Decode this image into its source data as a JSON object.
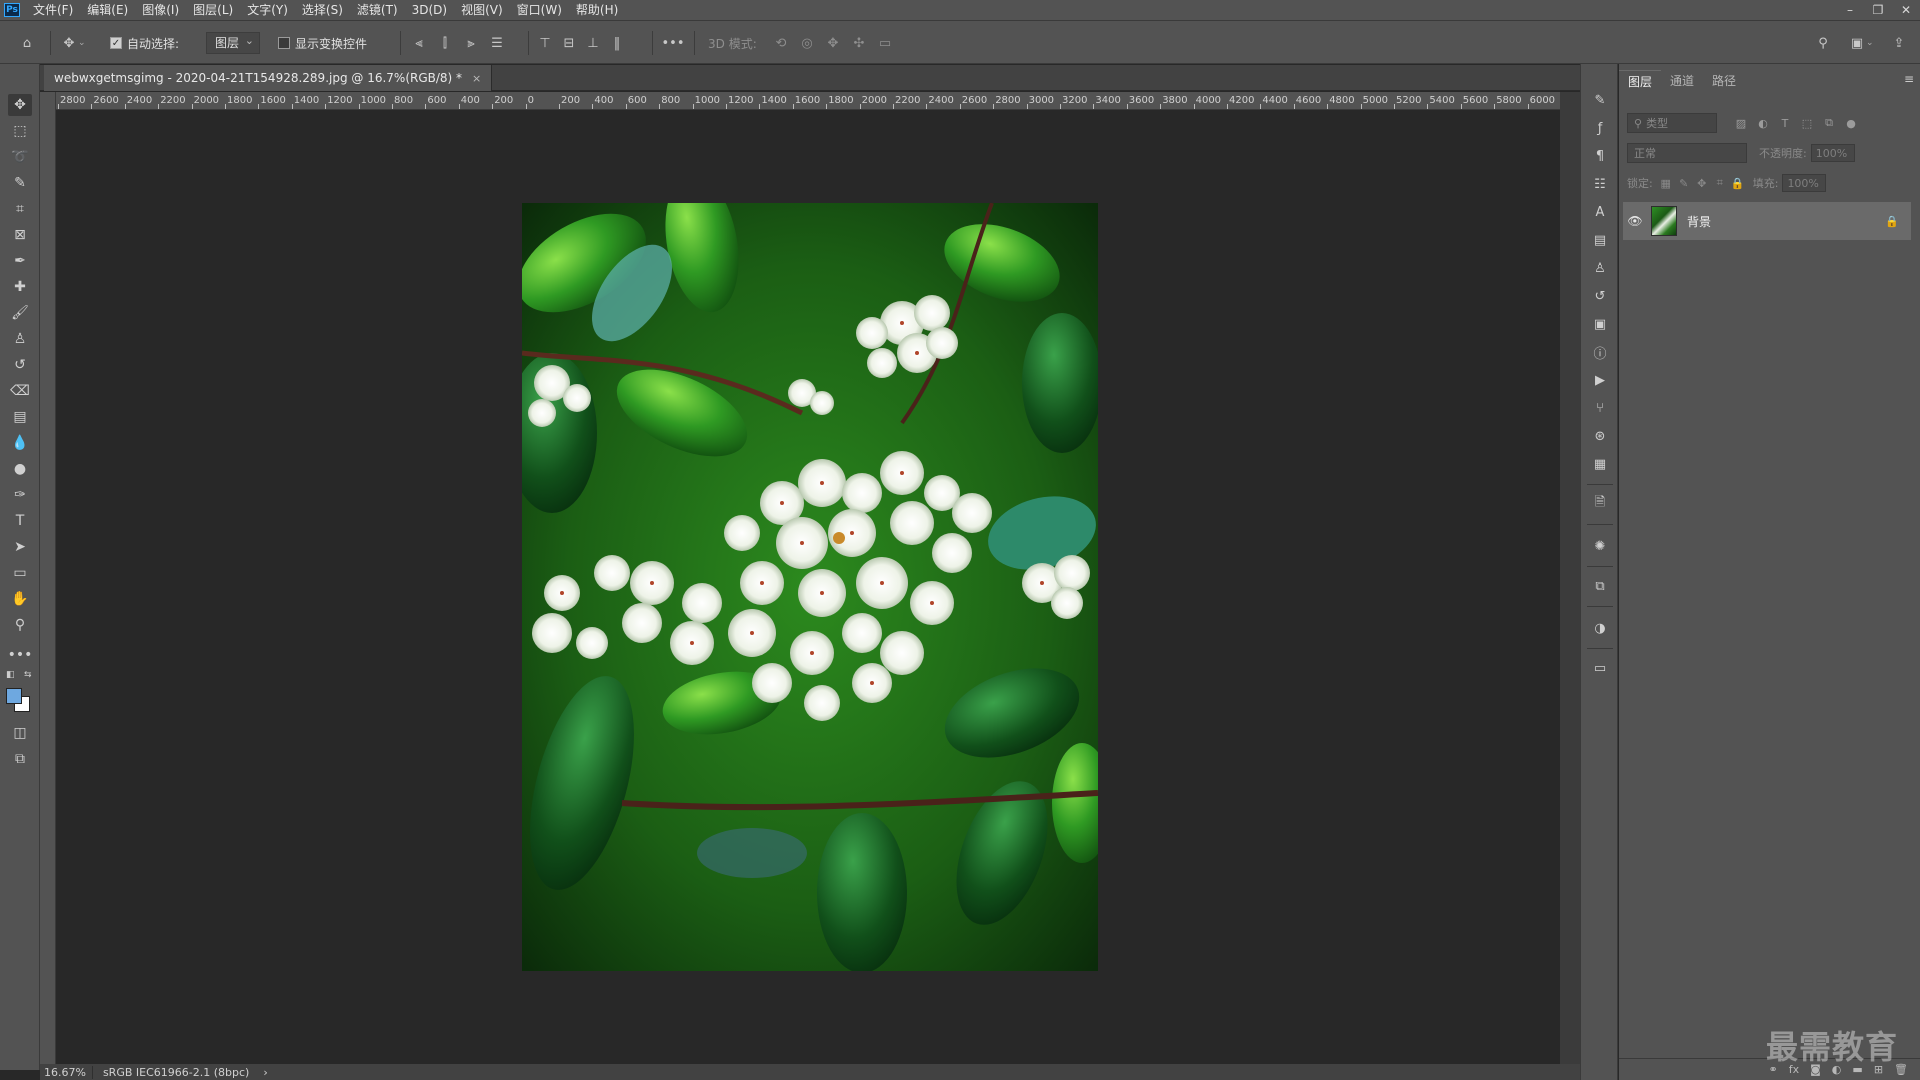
{
  "menubar": {
    "logo": "Ps",
    "items": [
      "文件(F)",
      "编辑(E)",
      "图像(I)",
      "图层(L)",
      "文字(Y)",
      "选择(S)",
      "滤镜(T)",
      "3D(D)",
      "视图(V)",
      "窗口(W)",
      "帮助(H)"
    ]
  },
  "options": {
    "auto_select_label": "自动选择:",
    "auto_select_checked": true,
    "target_value": "图层",
    "show_transform_label": "显示变换控件",
    "show_transform_checked": false,
    "mode_3d_label": "3D 模式:"
  },
  "document": {
    "tab_title": "webwxgetmsgimg - 2020-04-21T154928.289.jpg @ 16.7%(RGB/8) *",
    "ruler_labels": [
      "2800",
      "2600",
      "2400",
      "2200",
      "2000",
      "1800",
      "1600",
      "1400",
      "1200",
      "1000",
      "800",
      "600",
      "400",
      "200",
      "0",
      "200",
      "400",
      "600",
      "800",
      "1000",
      "1200",
      "1400",
      "1600",
      "1800",
      "2000",
      "2200",
      "2400",
      "2600",
      "2800",
      "3000",
      "3200",
      "3400",
      "3600",
      "3800",
      "4000",
      "4200",
      "4400",
      "4600",
      "4800",
      "5000",
      "5200",
      "5400",
      "5600",
      "5800",
      "6000"
    ]
  },
  "status": {
    "zoom": "16.67%",
    "profile": "sRGB IEC61966-2.1 (8bpc)"
  },
  "layers_panel": {
    "tabs": [
      "图层",
      "通道",
      "路径"
    ],
    "filter_placeholder": "类型",
    "blend_mode": "正常",
    "opacity_label": "不透明度:",
    "opacity_value": "100%",
    "lock_label": "锁定:",
    "fill_label": "填充:",
    "fill_value": "100%",
    "layers": [
      {
        "name": "背景",
        "visible": true,
        "locked": true
      }
    ]
  },
  "watermark": "最需教育",
  "colors": {
    "foreground": "#6ea8e0",
    "background": "#ffffff",
    "ui_panel": "#535353",
    "canvas_bg": "#282828"
  }
}
